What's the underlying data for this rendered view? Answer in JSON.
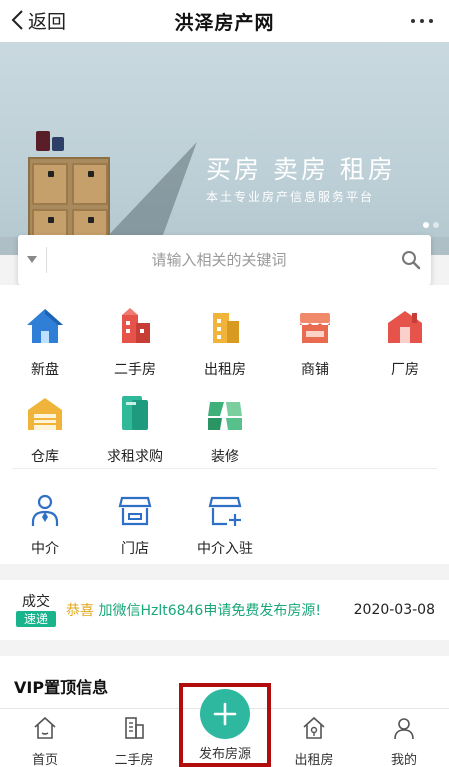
{
  "header": {
    "back_label": "返回",
    "title": "洪泽房产网"
  },
  "banner": {
    "slogan": "买房  卖房  租房",
    "subslogan": "本土专业房产信息服务平台"
  },
  "search": {
    "placeholder": "请输入相关的关键词"
  },
  "categories": [
    {
      "label": "新盘",
      "icon": "house-icon",
      "color": "#2f7fd6"
    },
    {
      "label": "二手房",
      "icon": "building-icon",
      "color": "#e5534b"
    },
    {
      "label": "出租房",
      "icon": "building-icon",
      "color": "#f0b43a"
    },
    {
      "label": "商铺",
      "icon": "shop-icon",
      "color": "#e86b4f"
    },
    {
      "label": "厂房",
      "icon": "factory-icon",
      "color": "#e5534b"
    },
    {
      "label": "仓库",
      "icon": "warehouse-icon",
      "color": "#f0b43a"
    },
    {
      "label": "求租求购",
      "icon": "cards-icon",
      "color": "#2fb89a"
    },
    {
      "label": "装修",
      "icon": "renovation-icon",
      "color": "#3fb07a"
    }
  ],
  "agents": [
    {
      "label": "中介",
      "icon": "agent-person-icon"
    },
    {
      "label": "门店",
      "icon": "store-icon"
    },
    {
      "label": "中介入驻",
      "icon": "store-add-icon"
    }
  ],
  "notice": {
    "deal_line1": "成交",
    "deal_line2": "速递",
    "highlight": "恭喜",
    "message": "加微信Hzlt6846申请免费发布房源!",
    "date": "2020-03-08"
  },
  "vip": {
    "title": "VIP置顶信息"
  },
  "nav": {
    "home": "首页",
    "second_hand": "二手房",
    "publish": "发布房源",
    "rental": "出租房",
    "mine": "我的"
  },
  "colors": {
    "accent": "#2fb8a0",
    "highlight_box": "#b10d0d",
    "notice_text": "#19a77a"
  }
}
